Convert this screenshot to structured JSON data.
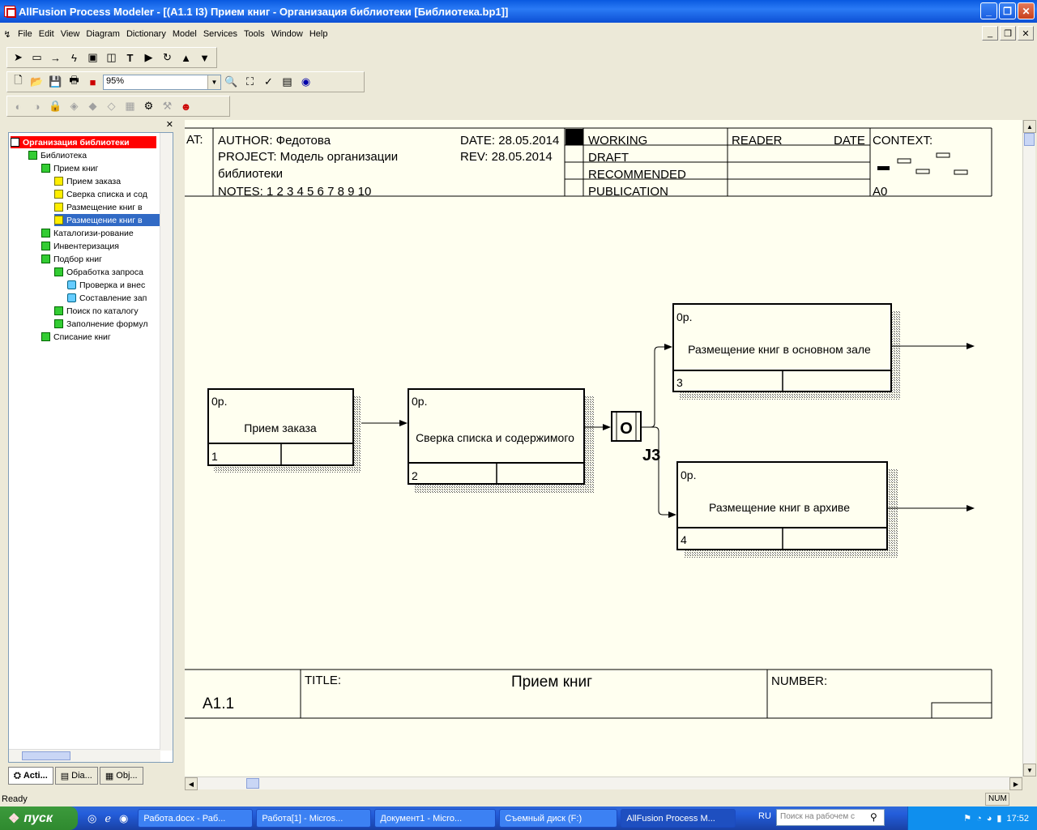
{
  "window": {
    "title": "AllFusion Process Modeler - [(A1.1 I3) Прием книг - Организация библиотеки  [Библиотека.bp1]]"
  },
  "menu": [
    "File",
    "Edit",
    "View",
    "Diagram",
    "Dictionary",
    "Model",
    "Services",
    "Tools",
    "Window",
    "Help"
  ],
  "toolbar": {
    "zoom": "95%"
  },
  "tree": {
    "root": "Организация библиотеки",
    "items": [
      {
        "label": "Библиотека",
        "level": 1,
        "icon": "g"
      },
      {
        "label": "Прием книг",
        "level": 2,
        "icon": "g"
      },
      {
        "label": "Прием заказа",
        "level": 3,
        "icon": "y"
      },
      {
        "label": "Сверка списка и сод",
        "level": 3,
        "icon": "y"
      },
      {
        "label": "Размещение книг в",
        "level": 3,
        "icon": "y"
      },
      {
        "label": "Размещение книг в",
        "level": 3,
        "icon": "y",
        "selected": true
      },
      {
        "label": "Каталогизи-рование",
        "level": 2,
        "icon": "g"
      },
      {
        "label": "Инвентеризация",
        "level": 2,
        "icon": "g"
      },
      {
        "label": "Подбор книг",
        "level": 2,
        "icon": "g"
      },
      {
        "label": "Обработка  запроса",
        "level": 3,
        "icon": "g"
      },
      {
        "label": "Проверка и внес",
        "level": 4,
        "icon": "c"
      },
      {
        "label": "Составление зап",
        "level": 4,
        "icon": "c"
      },
      {
        "label": "Поиск по каталогу",
        "level": 3,
        "icon": "g"
      },
      {
        "label": "Заполнение формул",
        "level": 3,
        "icon": "g"
      },
      {
        "label": "Списание книг",
        "level": 2,
        "icon": "g"
      }
    ],
    "tabs": [
      "Acti...",
      "Dia...",
      "Obj..."
    ]
  },
  "header": {
    "used_at": "AT:",
    "author": "AUTHOR:  Федотова",
    "date": "DATE:  28.05.2014",
    "project_line1": "PROJECT:  Модель организации",
    "project_line2": "библиотеки",
    "rev": "REV:    28.05.2014",
    "notes": "NOTES:  1  2  3  4  5  6  7  8  9  10",
    "status": [
      "WORKING",
      "DRAFT",
      "RECOMMENDED",
      "PUBLICATION"
    ],
    "reader": "READER",
    "reader_date": "DATE",
    "context": "CONTEXT:",
    "context_node": "A0"
  },
  "boxes": [
    {
      "label": "Прием заказа",
      "num": "1",
      "cost": "0р."
    },
    {
      "label": "Сверка списка и содержимого",
      "num": "2",
      "cost": "0р."
    },
    {
      "label": "Размещение книг в основном зале",
      "num": "3",
      "cost": "0р."
    },
    {
      "label": "Размещение книг в архиве",
      "num": "4",
      "cost": "0р."
    }
  ],
  "junction": {
    "type": "O",
    "label": "J3"
  },
  "footer": {
    "node": "A1.1",
    "title_label": "TITLE:",
    "title": "Прием книг",
    "number_label": "NUMBER:"
  },
  "status": {
    "text": "Ready",
    "num": "NUM"
  },
  "taskbar": {
    "start": "пуск",
    "tasks": [
      "Работа.docx - Раб...",
      "Работа[1] - Micros...",
      "Документ1 - Micro...",
      "Съемный диск (F:)",
      "AllFusion Process M..."
    ],
    "lang": "RU",
    "search": "Поиск на рабочем с",
    "time": "17:52"
  }
}
